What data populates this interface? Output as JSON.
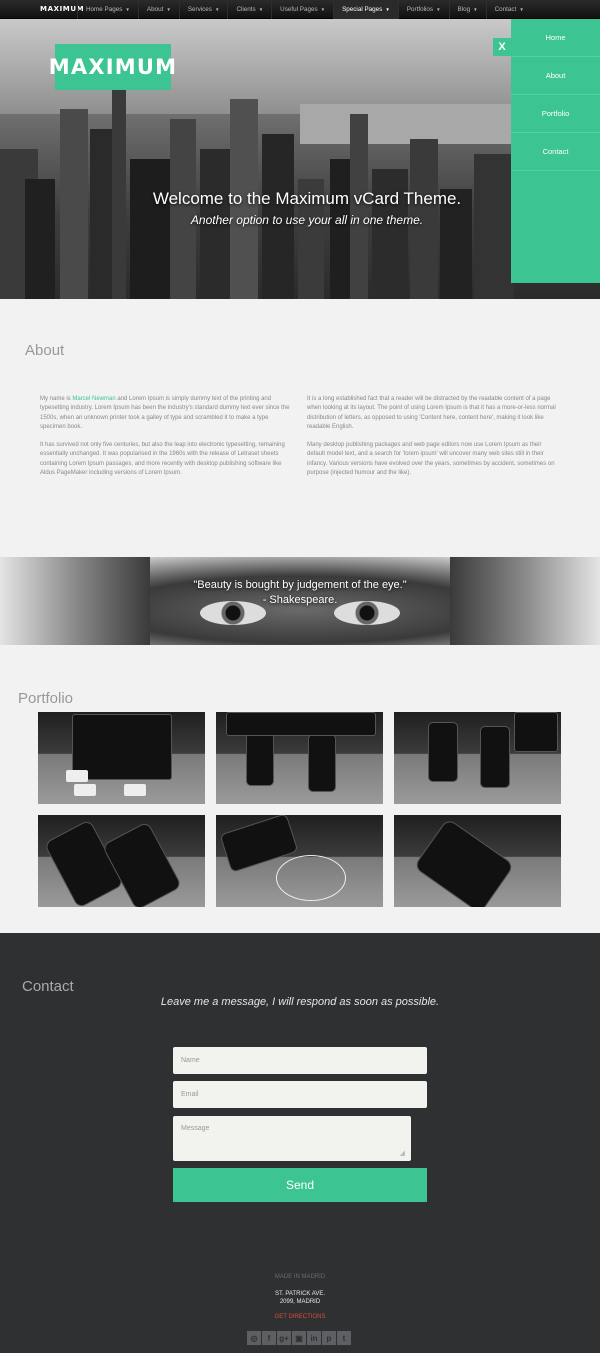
{
  "nav": {
    "brand": "MAXIMUM",
    "items": [
      {
        "label": "Home Pages"
      },
      {
        "label": "About"
      },
      {
        "label": "Services"
      },
      {
        "label": "Clients"
      },
      {
        "label": "Useful Pages"
      },
      {
        "label": "Special Pages",
        "active": true
      },
      {
        "label": "Portfolios"
      },
      {
        "label": "Blog"
      },
      {
        "label": "Contact"
      }
    ]
  },
  "hero": {
    "logo": "MAXIMUM",
    "title": "Welcome to the Maximum vCard Theme.",
    "subtitle": "Another option to use your all in one theme.",
    "close_label": "X"
  },
  "side_menu": {
    "items": [
      {
        "label": "Home"
      },
      {
        "label": "About"
      },
      {
        "label": "Portfolio"
      },
      {
        "label": "Contact"
      }
    ]
  },
  "about": {
    "title": "About",
    "col1_p1_pre": "My name is ",
    "col1_p1_link": "Marcel Newman",
    "col1_p1_post": " and Lorem Ipsum is simply dummy text of the printing and typesetting industry. Lorem Ipsum has been the industry's standard dummy text ever since the 1500s, when an unknown printer took a galley of type and scrambled it to make a type specimen book.",
    "col1_p2": "It has survived not only five centuries, but also the leap into electronic typesetting, remaining essentially unchanged. It was popularised in the 1960s with the release of Letraset sheets containing Lorem Ipsum passages, and more recently with desktop publishing software like Aldus PageMaker including versions of Lorem Ipsum.",
    "col2_p1": "It is a long established fact that a reader will be distracted by the readable content of a page when looking at its layout. The point of using Lorem Ipsum is that it has a more-or-less normal distribution of letters, as opposed to using 'Content here, content here', making it look like readable English.",
    "col2_p2": "Many desktop publishing packages and web page editors now use Lorem Ipsum as their default model text, and a search for 'lorem ipsum' will uncover many web sites still in their infancy. Various versions have evolved over the years, sometimes by accident, sometimes on purpose (injected humour and the like)."
  },
  "quote": {
    "text": "\"Beauty is bought by judgement of the eye.\"",
    "author": "- Shakespeare."
  },
  "portfolio": {
    "title": "Portfolio"
  },
  "contact": {
    "title": "Contact",
    "lead": "Leave me a message, I will respond as soon as possible.",
    "name_placeholder": "Name",
    "email_placeholder": "Email",
    "message_placeholder": "Message",
    "send_label": "Send"
  },
  "footer": {
    "made_in": "MADE IN MADRID",
    "address_line1": "ST. PATRICK AVE.",
    "address_line2": "2099, MADRID",
    "directions": "GET DIRECTIONS",
    "social": [
      {
        "icon": "dribbble-icon",
        "glyph": "◎"
      },
      {
        "icon": "facebook-icon",
        "glyph": "f"
      },
      {
        "icon": "google-plus-icon",
        "glyph": "g+"
      },
      {
        "icon": "instagram-icon",
        "glyph": "▣"
      },
      {
        "icon": "linkedin-icon",
        "glyph": "in"
      },
      {
        "icon": "pinterest-icon",
        "glyph": "p"
      },
      {
        "icon": "twitter-icon",
        "glyph": "t"
      }
    ]
  },
  "colors": {
    "accent": "#3cc592",
    "dark": "#2f3032",
    "directions": "#d94b3a"
  }
}
